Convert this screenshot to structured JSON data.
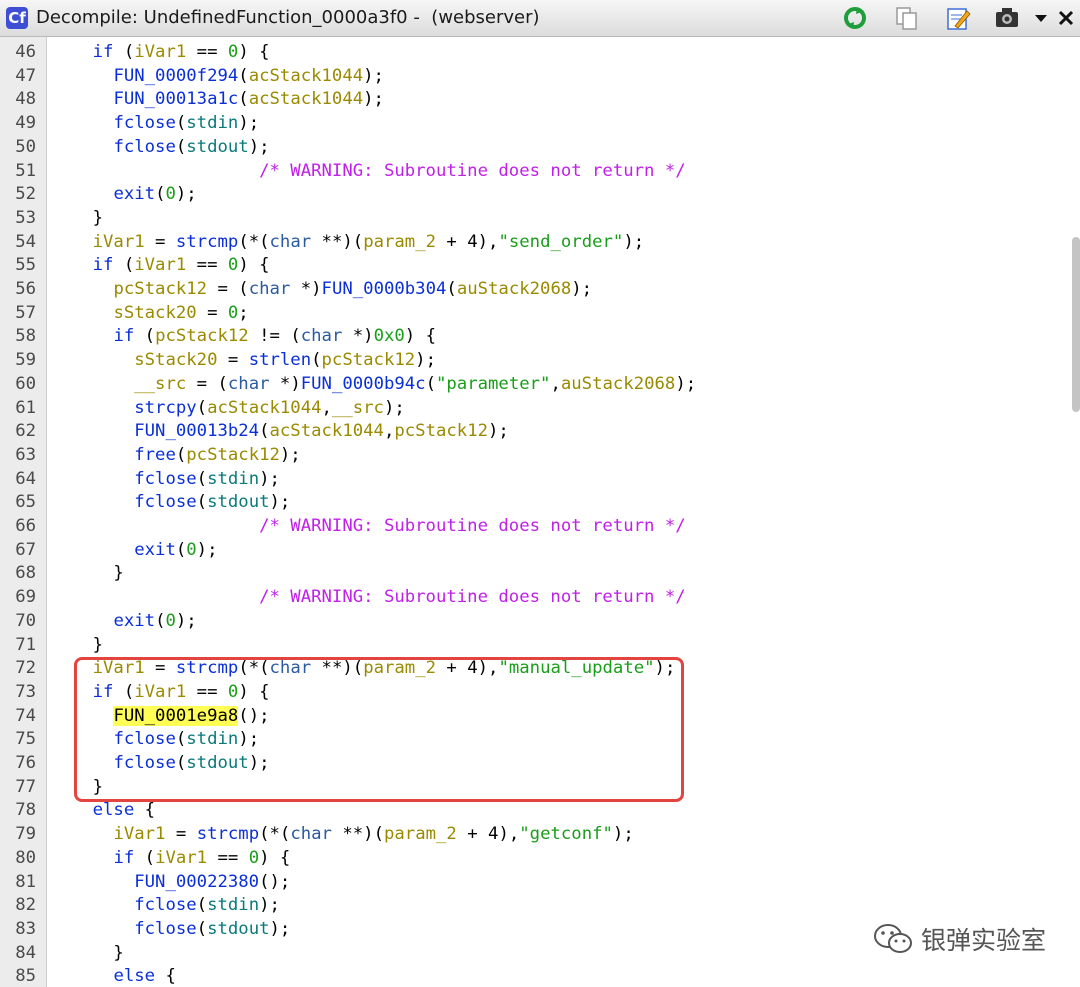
{
  "window": {
    "app_icon": "Cf",
    "title": "Decompile: UndefinedFunction_0000a3f0 -  (webserver)"
  },
  "toolbar": {
    "icons": [
      "refresh-icon",
      "copy-icon",
      "edit-icon",
      "snapshot-icon",
      "dropdown-icon",
      "close-icon"
    ]
  },
  "watermark": {
    "text": "银弹实验室"
  },
  "code": {
    "lines": [
      {
        "n": "46",
        "tokens": [
          [
            "p",
            "    "
          ],
          [
            "kw",
            "if"
          ],
          [
            "p",
            " ("
          ],
          [
            "v",
            "iVar1"
          ],
          [
            "p",
            " == "
          ],
          [
            "num",
            "0"
          ],
          [
            "p",
            ") {"
          ]
        ]
      },
      {
        "n": "47",
        "tokens": [
          [
            "p",
            "      "
          ],
          [
            "f",
            "FUN_0000f294"
          ],
          [
            "p",
            "("
          ],
          [
            "v",
            "acStack1044"
          ],
          [
            "p",
            ");"
          ]
        ]
      },
      {
        "n": "48",
        "tokens": [
          [
            "p",
            "      "
          ],
          [
            "f",
            "FUN_00013a1c"
          ],
          [
            "p",
            "("
          ],
          [
            "v",
            "acStack1044"
          ],
          [
            "p",
            ");"
          ]
        ]
      },
      {
        "n": "49",
        "tokens": [
          [
            "p",
            "      "
          ],
          [
            "f",
            "fclose"
          ],
          [
            "p",
            "("
          ],
          [
            "n",
            "stdin"
          ],
          [
            "p",
            ");"
          ]
        ]
      },
      {
        "n": "50",
        "tokens": [
          [
            "p",
            "      "
          ],
          [
            "f",
            "fclose"
          ],
          [
            "p",
            "("
          ],
          [
            "n",
            "stdout"
          ],
          [
            "p",
            ");"
          ]
        ]
      },
      {
        "n": "51",
        "tokens": [
          [
            "p",
            "                    "
          ],
          [
            "c",
            "/* WARNING: Subroutine does not return */"
          ]
        ]
      },
      {
        "n": "52",
        "tokens": [
          [
            "p",
            "      "
          ],
          [
            "f",
            "exit"
          ],
          [
            "p",
            "("
          ],
          [
            "num",
            "0"
          ],
          [
            "p",
            ");"
          ]
        ]
      },
      {
        "n": "53",
        "tokens": [
          [
            "p",
            "    }"
          ]
        ]
      },
      {
        "n": "54",
        "tokens": [
          [
            "p",
            "    "
          ],
          [
            "v",
            "iVar1"
          ],
          [
            "p",
            " = "
          ],
          [
            "f",
            "strcmp"
          ],
          [
            "p",
            "(*("
          ],
          [
            "t",
            "char"
          ],
          [
            "p",
            " **)("
          ],
          [
            "v",
            "param_2"
          ],
          [
            "p",
            " + 4),"
          ],
          [
            "s",
            "\"send_order\""
          ],
          [
            "p",
            ");"
          ]
        ]
      },
      {
        "n": "55",
        "tokens": [
          [
            "p",
            "    "
          ],
          [
            "kw",
            "if"
          ],
          [
            "p",
            " ("
          ],
          [
            "v",
            "iVar1"
          ],
          [
            "p",
            " == "
          ],
          [
            "num",
            "0"
          ],
          [
            "p",
            ") {"
          ]
        ]
      },
      {
        "n": "56",
        "tokens": [
          [
            "p",
            "      "
          ],
          [
            "v",
            "pcStack12"
          ],
          [
            "p",
            " = ("
          ],
          [
            "t",
            "char"
          ],
          [
            "p",
            " *)"
          ],
          [
            "f",
            "FUN_0000b304"
          ],
          [
            "p",
            "("
          ],
          [
            "v",
            "auStack2068"
          ],
          [
            "p",
            ");"
          ]
        ]
      },
      {
        "n": "57",
        "tokens": [
          [
            "p",
            "      "
          ],
          [
            "v",
            "sStack20"
          ],
          [
            "p",
            " = "
          ],
          [
            "num",
            "0"
          ],
          [
            "p",
            ";"
          ]
        ]
      },
      {
        "n": "58",
        "tokens": [
          [
            "p",
            "      "
          ],
          [
            "kw",
            "if"
          ],
          [
            "p",
            " ("
          ],
          [
            "v",
            "pcStack12"
          ],
          [
            "p",
            " != ("
          ],
          [
            "t",
            "char"
          ],
          [
            "p",
            " *)"
          ],
          [
            "num",
            "0x0"
          ],
          [
            "p",
            ") {"
          ]
        ]
      },
      {
        "n": "59",
        "tokens": [
          [
            "p",
            "        "
          ],
          [
            "v",
            "sStack20"
          ],
          [
            "p",
            " = "
          ],
          [
            "f",
            "strlen"
          ],
          [
            "p",
            "("
          ],
          [
            "v",
            "pcStack12"
          ],
          [
            "p",
            ");"
          ]
        ]
      },
      {
        "n": "60",
        "tokens": [
          [
            "p",
            "        "
          ],
          [
            "v",
            "__src"
          ],
          [
            "p",
            " = ("
          ],
          [
            "t",
            "char"
          ],
          [
            "p",
            " *)"
          ],
          [
            "f",
            "FUN_0000b94c"
          ],
          [
            "p",
            "("
          ],
          [
            "s",
            "\"parameter\""
          ],
          [
            "p",
            ","
          ],
          [
            "v",
            "auStack2068"
          ],
          [
            "p",
            ");"
          ]
        ]
      },
      {
        "n": "61",
        "tokens": [
          [
            "p",
            "        "
          ],
          [
            "f",
            "strcpy"
          ],
          [
            "p",
            "("
          ],
          [
            "v",
            "acStack1044"
          ],
          [
            "p",
            ","
          ],
          [
            "v",
            "__src"
          ],
          [
            "p",
            ");"
          ]
        ]
      },
      {
        "n": "62",
        "tokens": [
          [
            "p",
            "        "
          ],
          [
            "f",
            "FUN_00013b24"
          ],
          [
            "p",
            "("
          ],
          [
            "v",
            "acStack1044"
          ],
          [
            "p",
            ","
          ],
          [
            "v",
            "pcStack12"
          ],
          [
            "p",
            ");"
          ]
        ]
      },
      {
        "n": "63",
        "tokens": [
          [
            "p",
            "        "
          ],
          [
            "f",
            "free"
          ],
          [
            "p",
            "("
          ],
          [
            "v",
            "pcStack12"
          ],
          [
            "p",
            ");"
          ]
        ]
      },
      {
        "n": "64",
        "tokens": [
          [
            "p",
            "        "
          ],
          [
            "f",
            "fclose"
          ],
          [
            "p",
            "("
          ],
          [
            "n",
            "stdin"
          ],
          [
            "p",
            ");"
          ]
        ]
      },
      {
        "n": "65",
        "tokens": [
          [
            "p",
            "        "
          ],
          [
            "f",
            "fclose"
          ],
          [
            "p",
            "("
          ],
          [
            "n",
            "stdout"
          ],
          [
            "p",
            ");"
          ]
        ]
      },
      {
        "n": "66",
        "tokens": [
          [
            "p",
            "                    "
          ],
          [
            "c",
            "/* WARNING: Subroutine does not return */"
          ]
        ]
      },
      {
        "n": "67",
        "tokens": [
          [
            "p",
            "        "
          ],
          [
            "f",
            "exit"
          ],
          [
            "p",
            "("
          ],
          [
            "num",
            "0"
          ],
          [
            "p",
            ");"
          ]
        ]
      },
      {
        "n": "68",
        "tokens": [
          [
            "p",
            "      }"
          ]
        ]
      },
      {
        "n": "69",
        "tokens": [
          [
            "p",
            "                    "
          ],
          [
            "c",
            "/* WARNING: Subroutine does not return */"
          ]
        ]
      },
      {
        "n": "70",
        "tokens": [
          [
            "p",
            "      "
          ],
          [
            "f",
            "exit"
          ],
          [
            "p",
            "("
          ],
          [
            "num",
            "0"
          ],
          [
            "p",
            ");"
          ]
        ]
      },
      {
        "n": "71",
        "tokens": [
          [
            "p",
            "    }"
          ]
        ]
      },
      {
        "n": "72",
        "tokens": [
          [
            "p",
            "    "
          ],
          [
            "v",
            "iVar1"
          ],
          [
            "p",
            " = "
          ],
          [
            "f",
            "strcmp"
          ],
          [
            "p",
            "(*("
          ],
          [
            "t",
            "char"
          ],
          [
            "p",
            " **)("
          ],
          [
            "v",
            "param_2"
          ],
          [
            "p",
            " + 4),"
          ],
          [
            "s",
            "\"manual_update\""
          ],
          [
            "p",
            ");"
          ]
        ]
      },
      {
        "n": "73",
        "tokens": [
          [
            "p",
            "    "
          ],
          [
            "kw",
            "if"
          ],
          [
            "p",
            " ("
          ],
          [
            "v",
            "iVar1"
          ],
          [
            "p",
            " == "
          ],
          [
            "num",
            "0"
          ],
          [
            "p",
            ") {"
          ]
        ]
      },
      {
        "n": "74",
        "tokens": [
          [
            "p",
            "      "
          ],
          [
            "hl",
            "FUN_0001e9a8"
          ],
          [
            "p",
            "();"
          ]
        ]
      },
      {
        "n": "75",
        "tokens": [
          [
            "p",
            "      "
          ],
          [
            "f",
            "fclose"
          ],
          [
            "p",
            "("
          ],
          [
            "n",
            "stdin"
          ],
          [
            "p",
            ");"
          ]
        ]
      },
      {
        "n": "76",
        "tokens": [
          [
            "p",
            "      "
          ],
          [
            "f",
            "fclose"
          ],
          [
            "p",
            "("
          ],
          [
            "n",
            "stdout"
          ],
          [
            "p",
            ");"
          ]
        ]
      },
      {
        "n": "77",
        "tokens": [
          [
            "p",
            "    }"
          ]
        ]
      },
      {
        "n": "78",
        "tokens": [
          [
            "p",
            "    "
          ],
          [
            "kw",
            "else"
          ],
          [
            "p",
            " {"
          ]
        ]
      },
      {
        "n": "79",
        "tokens": [
          [
            "p",
            "      "
          ],
          [
            "v",
            "iVar1"
          ],
          [
            "p",
            " = "
          ],
          [
            "f",
            "strcmp"
          ],
          [
            "p",
            "(*("
          ],
          [
            "t",
            "char"
          ],
          [
            "p",
            " **)("
          ],
          [
            "v",
            "param_2"
          ],
          [
            "p",
            " + 4),"
          ],
          [
            "s",
            "\"getconf\""
          ],
          [
            "p",
            ");"
          ]
        ]
      },
      {
        "n": "80",
        "tokens": [
          [
            "p",
            "      "
          ],
          [
            "kw",
            "if"
          ],
          [
            "p",
            " ("
          ],
          [
            "v",
            "iVar1"
          ],
          [
            "p",
            " == "
          ],
          [
            "num",
            "0"
          ],
          [
            "p",
            ") {"
          ]
        ]
      },
      {
        "n": "81",
        "tokens": [
          [
            "p",
            "        "
          ],
          [
            "f",
            "FUN_00022380"
          ],
          [
            "p",
            "();"
          ]
        ]
      },
      {
        "n": "82",
        "tokens": [
          [
            "p",
            "        "
          ],
          [
            "f",
            "fclose"
          ],
          [
            "p",
            "("
          ],
          [
            "n",
            "stdin"
          ],
          [
            "p",
            ");"
          ]
        ]
      },
      {
        "n": "83",
        "tokens": [
          [
            "p",
            "        "
          ],
          [
            "f",
            "fclose"
          ],
          [
            "p",
            "("
          ],
          [
            "n",
            "stdout"
          ],
          [
            "p",
            ");"
          ]
        ]
      },
      {
        "n": "84",
        "tokens": [
          [
            "p",
            "      }"
          ]
        ]
      },
      {
        "n": "85",
        "tokens": [
          [
            "p",
            "      "
          ],
          [
            "kw",
            "else"
          ],
          [
            "p",
            " {"
          ]
        ]
      }
    ]
  }
}
